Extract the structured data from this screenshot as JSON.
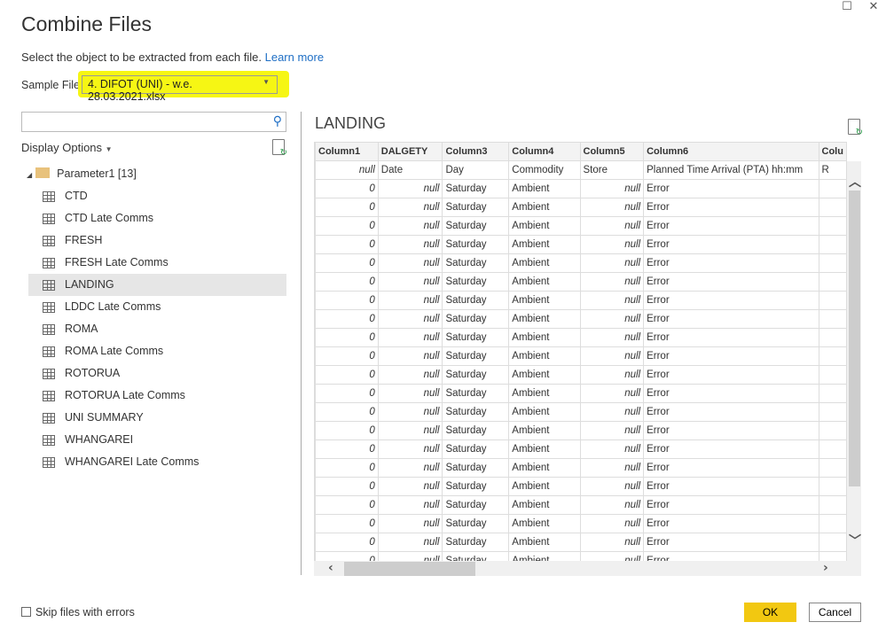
{
  "window": {
    "title": "Combine Files",
    "maximize_icon": "maximize-icon",
    "close_icon": "close-icon"
  },
  "intro": {
    "text": "Select the object to be extracted from each file.",
    "link": "Learn more"
  },
  "sample_file": {
    "label": "Sample File:",
    "value": "4. DIFOT (UNI) - w.e. 28.03.2021.xlsx",
    "highlight": "#f6f614"
  },
  "search": {
    "placeholder": "",
    "value": ""
  },
  "display_options": "Display Options",
  "tree": {
    "root": "Parameter1 [13]",
    "selected": "LANDING",
    "items": [
      "CTD",
      "CTD Late Comms",
      "FRESH",
      "FRESH Late Comms",
      "LANDING",
      "LDDC Late Comms",
      "ROMA",
      "ROMA Late Comms",
      "ROTORUA",
      "ROTORUA Late Comms",
      "UNI SUMMARY",
      "WHANGAREI",
      "WHANGAREI Late Comms"
    ]
  },
  "preview": {
    "title": "LANDING",
    "columns": [
      "Column1",
      "DALGETY",
      "Column3",
      "Column4",
      "Column5",
      "Column6",
      "Colu"
    ],
    "first_row": [
      "null",
      "Date",
      "Day",
      "Commodity",
      "Store",
      "Planned Time Arrival (PTA) hh:mm",
      "R"
    ],
    "row": [
      "0",
      "null",
      "Saturday",
      "Ambient",
      "null",
      "Error",
      ""
    ],
    "row_count_visible": 21
  },
  "footer": {
    "skip_label": "Skip files with errors",
    "skip_checked": false,
    "ok": "OK",
    "cancel": "Cancel",
    "ok_color": "#f2c811"
  }
}
